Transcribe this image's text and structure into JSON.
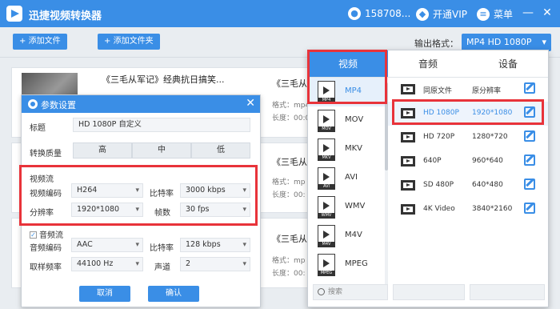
{
  "app": {
    "title": "迅捷视频转换器",
    "user": "158708...",
    "vip": "开通VIP",
    "menu": "菜单",
    "minimize": "—",
    "close": "✕"
  },
  "toolbar": {
    "add_file": "添加文件",
    "add_folder": "添加文件夹",
    "output_label": "输出格式：",
    "output_value": "MP4  HD 1080P"
  },
  "files": [
    {
      "title": "《三毛从军记》经典抗日搞笑...",
      "title2": "《三毛从",
      "fmt": "格式：mp4",
      "len": "长度：00:00"
    },
    {
      "title2": "《三毛从",
      "fmt": "格式：mp",
      "len": "长度：00:"
    },
    {
      "title2": "《三毛从",
      "fmt": "格式：mp",
      "len": "长度：00:"
    }
  ],
  "dialog": {
    "title": "参数设置",
    "title_label": "标题",
    "title_value": "HD 1080P 自定义",
    "quality_label": "转换质量",
    "quality_high": "高",
    "quality_mid": "中",
    "quality_low": "低",
    "video_section": "视频流",
    "vcodec_label": "视频编码",
    "vcodec": "H264",
    "bitrate_label": "比特率",
    "bitrate": "3000 kbps",
    "res_label": "分辨率",
    "res": "1920*1080",
    "fps_label": "帧数",
    "fps": "30 fps",
    "audio_section": "音频流",
    "acodec_label": "音频编码",
    "acodec": "AAC",
    "abitrate_label": "比特率",
    "abitrate": "128 kbps",
    "samplerate_label": "取样频率",
    "samplerate": "44100 Hz",
    "channel_label": "声道",
    "channel": "2",
    "cancel": "取消",
    "ok": "确认"
  },
  "format_panel": {
    "tabs": [
      "视频",
      "音频",
      "设备"
    ],
    "formats": [
      "MP4",
      "MOV",
      "MKV",
      "AVI",
      "WMV",
      "M4V",
      "MPEG"
    ],
    "resolutions": [
      {
        "name": "同原文件",
        "value": "原分辨率"
      },
      {
        "name": "HD 1080P",
        "value": "1920*1080"
      },
      {
        "name": "HD 720P",
        "value": "1280*720"
      },
      {
        "name": "640P",
        "value": "960*640"
      },
      {
        "name": "SD 480P",
        "value": "640*480"
      },
      {
        "name": "4K Video",
        "value": "3840*2160"
      }
    ],
    "search_placeholder": "搜索"
  },
  "colors": {
    "accent": "#3a8ee6",
    "highlight": "#e8333a"
  }
}
